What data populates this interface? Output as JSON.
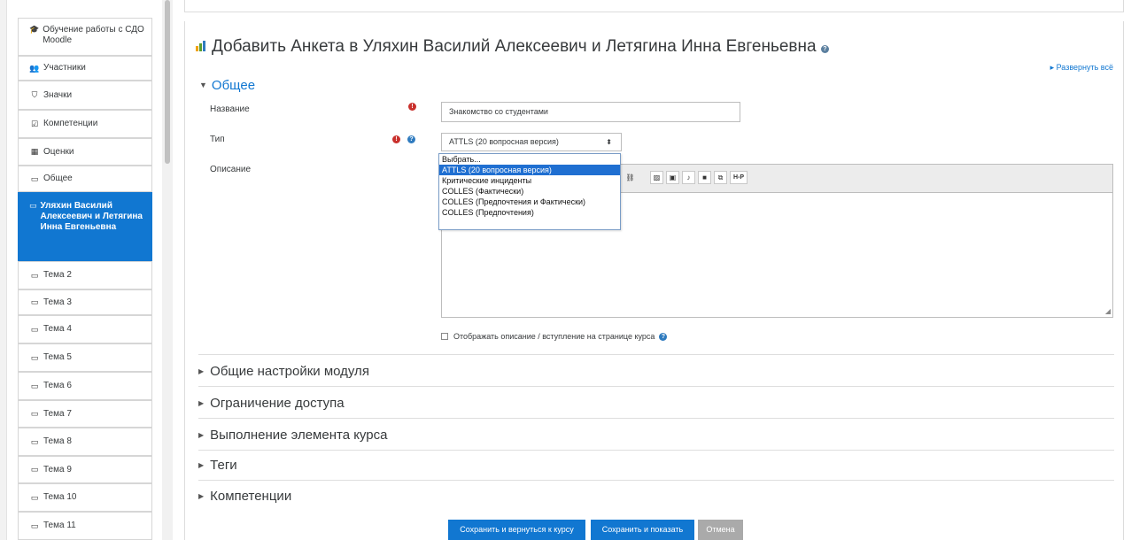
{
  "sidebar": {
    "items": [
      {
        "label": "Обучение работы с СДО Moodle",
        "icon": "graduation-cap-icon",
        "glyph": "🎓"
      },
      {
        "label": "Участники",
        "icon": "users-icon",
        "glyph": "👥"
      },
      {
        "label": "Значки",
        "icon": "shield-icon",
        "glyph": "⛉"
      },
      {
        "label": "Компетенции",
        "icon": "checkbox-icon",
        "glyph": "☑"
      },
      {
        "label": "Оценки",
        "icon": "table-icon",
        "glyph": "▦"
      },
      {
        "label": "Общее",
        "icon": "folder-icon",
        "glyph": "▭"
      },
      {
        "label": "Уляхин Василий Алексеевич и Летягина Инна Евгеньевна",
        "icon": "folder-icon",
        "glyph": "▭"
      },
      {
        "label": "Тема 2",
        "icon": "folder-icon",
        "glyph": "▭"
      },
      {
        "label": "Тема 3",
        "icon": "folder-icon",
        "glyph": "▭"
      },
      {
        "label": "Тема 4",
        "icon": "folder-icon",
        "glyph": "▭"
      },
      {
        "label": "Тема 5",
        "icon": "folder-icon",
        "glyph": "▭"
      },
      {
        "label": "Тема 6",
        "icon": "folder-icon",
        "glyph": "▭"
      },
      {
        "label": "Тема 7",
        "icon": "folder-icon",
        "glyph": "▭"
      },
      {
        "label": "Тема 8",
        "icon": "folder-icon",
        "glyph": "▭"
      },
      {
        "label": "Тема 9",
        "icon": "folder-icon",
        "glyph": "▭"
      },
      {
        "label": "Тема 10",
        "icon": "folder-icon",
        "glyph": "▭"
      },
      {
        "label": "Тема 11",
        "icon": "folder-icon",
        "glyph": "▭"
      }
    ]
  },
  "page": {
    "title": "Добавить Анкета в Уляхин Василий Алексеевич и Летягина Инна Евгеньевна",
    "expand_all": "▸ Развернуть всё"
  },
  "general": {
    "heading": "Общее",
    "name_label": "Название",
    "name_value": "Знакомство со студентами",
    "type_label": "Тип",
    "type_value": "ATTLS (20 вопросная версия)",
    "description_label": "Описание",
    "type_options": [
      "Выбрать...",
      "ATTLS (20 вопросная версия)",
      "Критические инциденты",
      "COLLES (Фактически)",
      "COLLES (Предпочтения и Фактически)",
      "COLLES (Предпочтения)"
    ],
    "show_description_label": "Отображать описание / вступление на странице курса"
  },
  "editor": {
    "toolbar_icons": [
      "unlink-icon",
      "image-icon",
      "media-icon",
      "microphone-icon",
      "video-icon",
      "copy-icon",
      "h5p-icon"
    ],
    "h5p_label": "H-P"
  },
  "sections": [
    "Общие настройки модуля",
    "Ограничение доступа",
    "Выполнение элемента курса",
    "Теги",
    "Компетенции"
  ],
  "buttons": {
    "save_return": "Сохранить и вернуться к курсу",
    "save_display": "Сохранить и показать",
    "cancel": "Отмена"
  },
  "colors": {
    "accent": "#1177d1",
    "required": "#c9302c",
    "help": "#2f7bbf"
  }
}
